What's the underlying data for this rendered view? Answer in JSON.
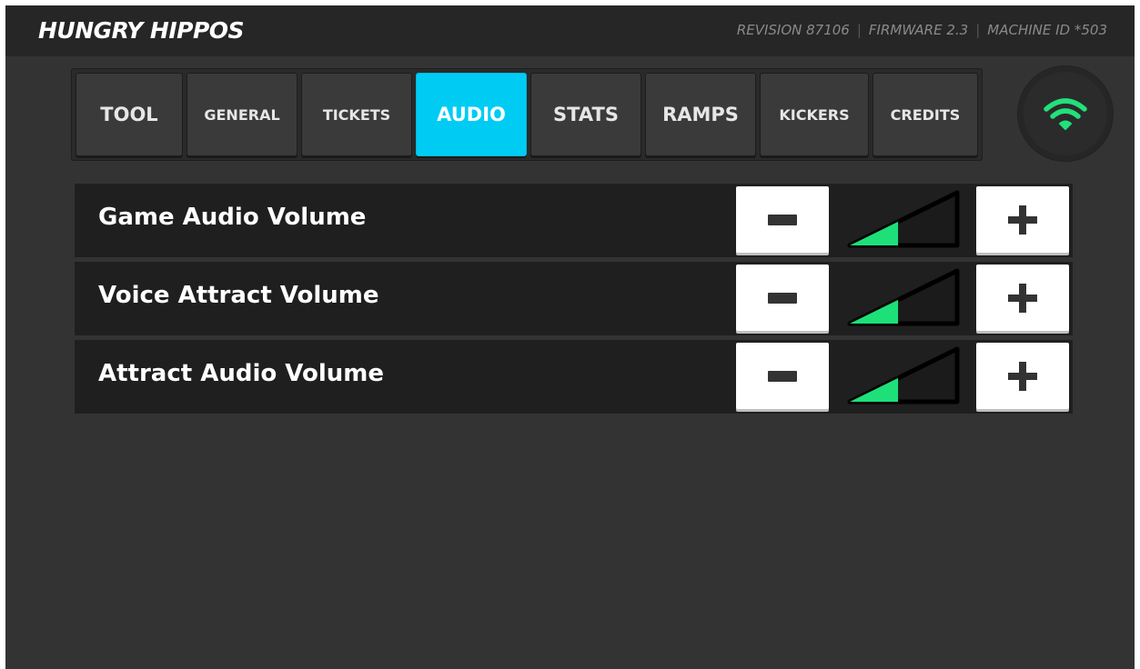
{
  "header": {
    "title": "HUNGRY HIPPOS",
    "revision": "REVISION 87106",
    "firmware": "FIRMWARE 2.3",
    "machine_id": "MACHINE ID *503"
  },
  "tabs": [
    {
      "label": "TOOL",
      "active": false
    },
    {
      "label": "GENERAL",
      "active": false
    },
    {
      "label": "TICKETS",
      "active": false
    },
    {
      "label": "AUDIO",
      "active": true
    },
    {
      "label": "STATS",
      "active": false
    },
    {
      "label": "RAMPS",
      "active": false
    },
    {
      "label": "KICKERS",
      "active": false
    },
    {
      "label": "CREDITS",
      "active": false
    }
  ],
  "wifi": {
    "icon": "wifi-icon",
    "color": "#22e07a"
  },
  "settings": [
    {
      "label": "Game Audio Volume",
      "level": 0.45
    },
    {
      "label": "Voice Attract Volume",
      "level": 0.45
    },
    {
      "label": "Attract Audio Volume",
      "level": 0.45
    }
  ],
  "colors": {
    "accent": "#00ccf3",
    "meter_fill": "#1de079"
  }
}
